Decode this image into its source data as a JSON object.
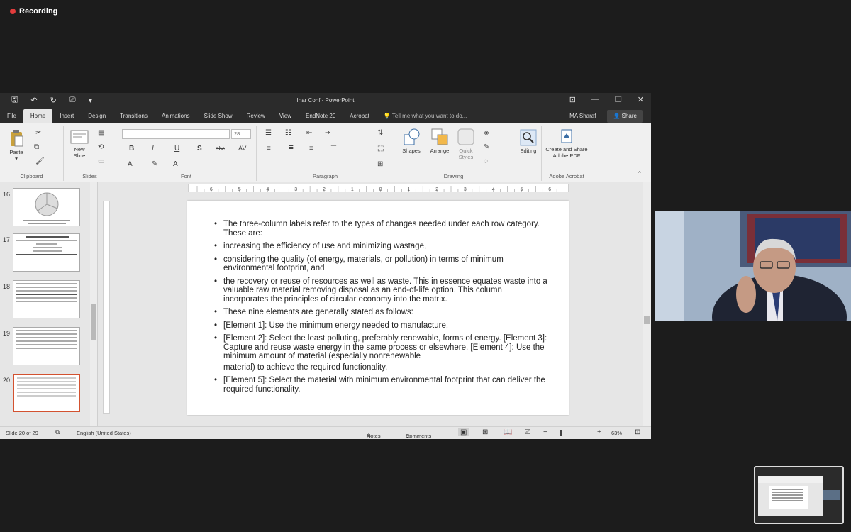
{
  "recording": {
    "label": "Recording",
    "color": "#e23c3c"
  },
  "window": {
    "title": "Inar Conf - PowerPoint",
    "qat_icons": [
      "save-icon",
      "undo-icon",
      "redo-icon",
      "presenter-icon",
      "customize-icon"
    ]
  },
  "tabs": {
    "items": [
      "File",
      "Home",
      "Insert",
      "Design",
      "Transitions",
      "Animations",
      "Slide Show",
      "Review",
      "View",
      "EndNote 20",
      "Acrobat"
    ],
    "active": "Home",
    "tell_me": "Tell me what you want to do...",
    "user": "MA Sharaf",
    "share": "Share"
  },
  "ribbon": {
    "clipboard": {
      "paste": "Paste",
      "label": "Clipboard"
    },
    "slides": {
      "new_slide": "New Slide",
      "label": "Slides"
    },
    "font": {
      "size": "28",
      "label": "Font",
      "buttons": [
        "B",
        "I",
        "U",
        "S",
        "abc",
        "AV"
      ]
    },
    "paragraph": {
      "label": "Paragraph"
    },
    "drawing": {
      "shapes": "Shapes",
      "arrange": "Arrange",
      "quick_styles": "Quick Styles",
      "label": "Drawing"
    },
    "editing": {
      "label": "Editing"
    },
    "acrobat": {
      "create_share": "Create and Share Adobe PDF",
      "label": "Adobe Acrobat"
    }
  },
  "thumbnails": [
    {
      "num": "16",
      "selected": false
    },
    {
      "num": "17",
      "selected": false
    },
    {
      "num": "18",
      "selected": false
    },
    {
      "num": "19",
      "selected": false
    },
    {
      "num": "20",
      "selected": true
    }
  ],
  "ruler": {
    "marks": [
      "6",
      "5",
      "4",
      "3",
      "2",
      "1",
      "0",
      "1",
      "2",
      "3",
      "4",
      "5",
      "6"
    ]
  },
  "slide": {
    "bullets": [
      {
        "text": "The three-column labels refer to the types of changes needed under each row category. These are:",
        "cont": false
      },
      {
        "text": "increasing the efficiency of use and minimizing wastage,",
        "cont": false
      },
      {
        "text": "considering the quality (of energy, materials, or pollution) in terms of minimum environmental footprint, and",
        "cont": false
      },
      {
        "text": "the recovery or reuse of resources as well as waste. This in essence equates waste into a valuable raw material removing disposal as an end-of-life option. This column incorporates the principles of circular economy into the matrix.",
        "cont": false
      },
      {
        "text": "These nine elements are generally stated as follows:",
        "cont": false
      },
      {
        "text": "[Element 1]: Use the minimum energy needed to manufacture,",
        "cont": false
      },
      {
        "text": "[Element 2]: Select the least polluting, preferably renewable, forms of energy. [Element 3]: Capture and reuse waste energy in the same process or elsewhere. [Element 4]: Use the minimum amount of material (especially nonrenewable",
        "cont": false
      },
      {
        "text": "material) to achieve the required functionality.",
        "cont": true
      },
      {
        "text": "[Element 5]: Select the material with minimum environmental footprint that can deliver the required functionality.",
        "cont": false
      }
    ]
  },
  "status": {
    "slide_of": "Slide 20 of 29",
    "language": "English (United States)",
    "notes": "Notes",
    "comments": "Comments",
    "zoom": "63%"
  }
}
